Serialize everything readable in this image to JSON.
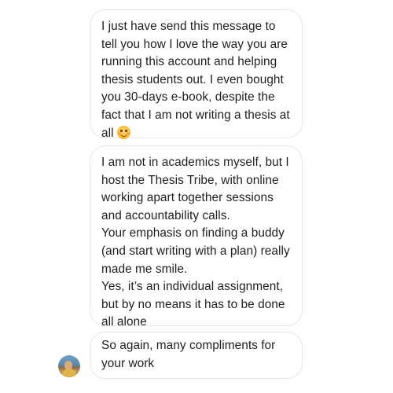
{
  "conversation": {
    "messages": [
      {
        "paragraphs": [
          "I just have send this message to tell you how I love the way you are running this account and helping thesis students out. I even bought you 30-days e-book, despite the fact that I am not writing a thesis at all"
        ],
        "trailing_emoji": "smiling-face-emoji"
      },
      {
        "paragraphs": [
          "I am not in academics myself, but I host the Thesis Tribe, with online working apart together sessions and accountability calls.",
          "Your emphasis on finding a buddy (and start writing with a plan) really made me smile.",
          "Yes, it’s an individual assignment, but by no means it has to be done all alone"
        ]
      },
      {
        "paragraphs": [
          "So again, many compliments for your work"
        ]
      }
    ]
  },
  "colors": {
    "bubble_border": "#e6e6e6",
    "text": "#1f1f1f",
    "background": "#ffffff"
  }
}
